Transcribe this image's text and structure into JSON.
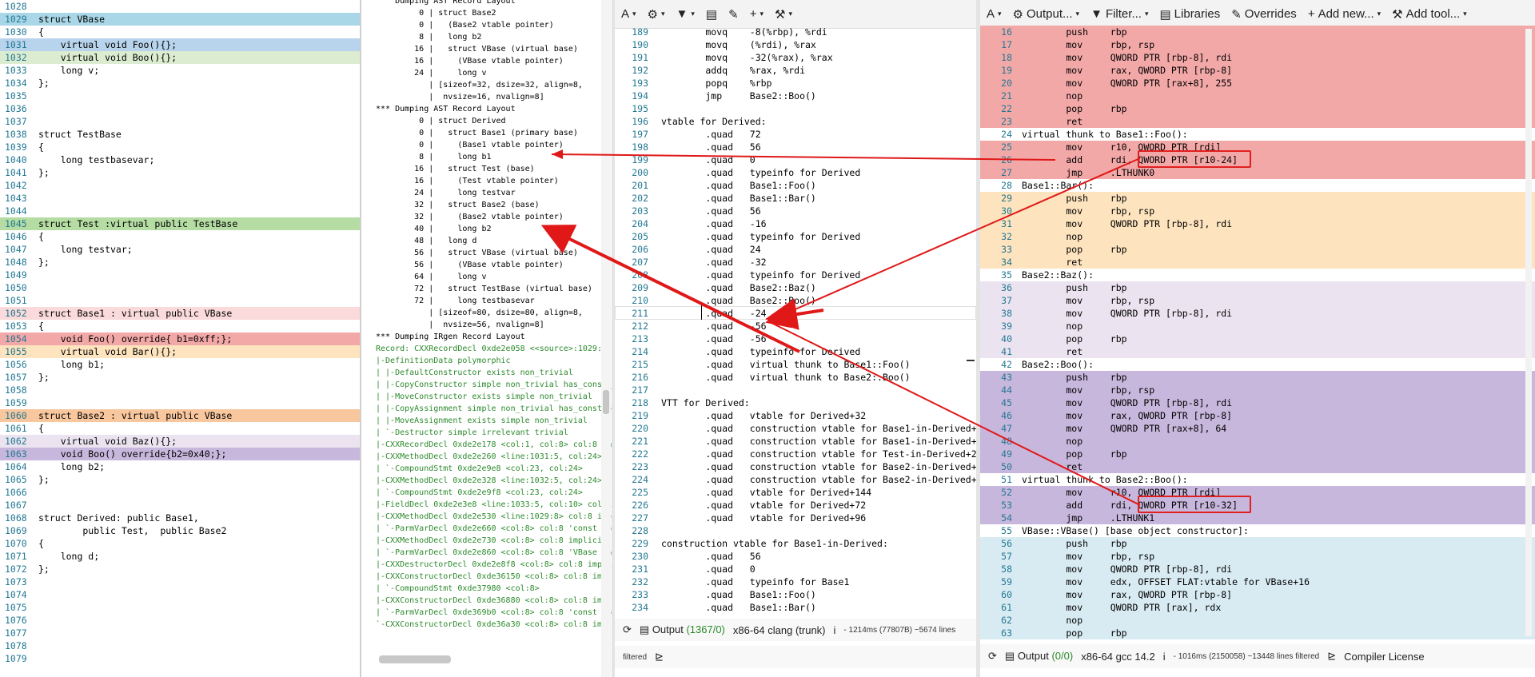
{
  "source_lines": [
    {
      "n": "1028",
      "t": ""
    },
    {
      "n": "1029",
      "t": "struct VBase",
      "cls": "hl-blue",
      "kind": "vbase"
    },
    {
      "n": "1030",
      "t": "{"
    },
    {
      "n": "1031",
      "t": "    virtual void Foo(){};",
      "cls": "hl-blue2"
    },
    {
      "n": "1032",
      "t": "    virtual void Boo(){};",
      "cls": "hl-green"
    },
    {
      "n": "1033",
      "t": "    long v;"
    },
    {
      "n": "1034",
      "t": "};"
    },
    {
      "n": "1035",
      "t": ""
    },
    {
      "n": "1036",
      "t": ""
    },
    {
      "n": "1037",
      "t": ""
    },
    {
      "n": "1038",
      "t": "struct TestBase"
    },
    {
      "n": "1039",
      "t": "{"
    },
    {
      "n": "1040",
      "t": "    long testbasevar;"
    },
    {
      "n": "1041",
      "t": "};"
    },
    {
      "n": "1042",
      "t": ""
    },
    {
      "n": "1043",
      "t": ""
    },
    {
      "n": "1044",
      "t": ""
    },
    {
      "n": "1045",
      "t": "struct Test :virtual public TestBase",
      "cls": "hl-green2"
    },
    {
      "n": "1046",
      "t": "{"
    },
    {
      "n": "1047",
      "t": "    long testvar;"
    },
    {
      "n": "1048",
      "t": "};"
    },
    {
      "n": "1049",
      "t": ""
    },
    {
      "n": "1050",
      "t": ""
    },
    {
      "n": "1051",
      "t": ""
    },
    {
      "n": "1052",
      "t": "struct Base1 : virtual public VBase",
      "cls": "hl-pink"
    },
    {
      "n": "1053",
      "t": "{"
    },
    {
      "n": "1054",
      "t": "    void Foo() override{ b1=0xff;};",
      "cls": "hl-red"
    },
    {
      "n": "1055",
      "t": "    virtual void Bar(){};",
      "cls": "hl-orange"
    },
    {
      "n": "1056",
      "t": "    long b1;"
    },
    {
      "n": "1057",
      "t": "};"
    },
    {
      "n": "1058",
      "t": ""
    },
    {
      "n": "1059",
      "t": ""
    },
    {
      "n": "1060",
      "t": "struct Base2 : virtual public VBase",
      "cls": "hl-orange2"
    },
    {
      "n": "1061",
      "t": "{"
    },
    {
      "n": "1062",
      "t": "    virtual void Baz(){};",
      "cls": "hl-lav"
    },
    {
      "n": "1063",
      "t": "    void Boo() override{b2=0x40;};",
      "cls": "hl-purple"
    },
    {
      "n": "1064",
      "t": "    long b2;"
    },
    {
      "n": "1065",
      "t": "};"
    },
    {
      "n": "1066",
      "t": ""
    },
    {
      "n": "1067",
      "t": ""
    },
    {
      "n": "1068",
      "t": "struct Derived: public Base1,"
    },
    {
      "n": "1069",
      "t": "        public Test,  public Base2"
    },
    {
      "n": "1070",
      "t": "{"
    },
    {
      "n": "1071",
      "t": "    long d;"
    },
    {
      "n": "1072",
      "t": "};"
    },
    {
      "n": "1073",
      "t": ""
    },
    {
      "n": "1074",
      "t": ""
    },
    {
      "n": "1075",
      "t": ""
    },
    {
      "n": "1076",
      "t": ""
    },
    {
      "n": "1077",
      "t": ""
    },
    {
      "n": "1078",
      "t": ""
    },
    {
      "n": "1079",
      "t": ""
    }
  ],
  "ast_lines": [
    "    Dumping AST Record Layout",
    "         0 | struct Base2",
    "         0 |   (Base2 vtable pointer)",
    "         8 |   long b2",
    "        16 |   struct VBase (virtual base)",
    "        16 |     (VBase vtable pointer)",
    "        24 |     long v",
    "           | [sizeof=32, dsize=32, align=8,",
    "           |  nvsize=16, nvalign=8]",
    "",
    "*** Dumping AST Record Layout",
    "         0 | struct Derived",
    "         0 |   struct Base1 (primary base)",
    "         0 |     (Base1 vtable pointer)",
    "         8 |     long b1",
    "        16 |   struct Test (base)",
    "        16 |     (Test vtable pointer)",
    "        24 |     long testvar",
    "        32 |   struct Base2 (base)",
    "        32 |     (Base2 vtable pointer)",
    "        40 |     long b2",
    "        48 |   long d",
    "        56 |   struct VBase (virtual base)",
    "        56 |     (VBase vtable pointer)",
    "        64 |     long v",
    "        72 |   struct TestBase (virtual base)",
    "        72 |     long testbasevar",
    "           | [sizeof=80, dsize=80, align=8,",
    "           |  nvsize=56, nvalign=8]",
    "",
    "*** Dumping IRgen Record Layout",
    "Record: CXXRecordDecl 0xde2e058 <<source>:1029:1, l",
    "|-DefinitionData polymorphic",
    "| |-DefaultConstructor exists non_trivial",
    "| |-CopyConstructor simple non_trivial has_const_pa",
    "| |-MoveConstructor exists simple non_trivial",
    "| |-CopyAssignment simple non_trivial has_const_par",
    "| |-MoveAssignment exists simple non_trivial",
    "| `-Destructor simple irrelevant trivial",
    "|-CXXRecordDecl 0xde2e178 <col:1, col:8> col:8 impl",
    "|-CXXMethodDecl 0xde2e260 <line:1031:5, col:24> col",
    "| `-CompoundStmt 0xde2e9e8 <col:23, col:24>",
    "|-CXXMethodDecl 0xde2e328 <line:1032:5, col:24> col",
    "| `-CompoundStmt 0xde2e9f8 <col:23, col:24>",
    "|-FieldDecl 0xde2e3e8 <line:1033:5, col:10> col:10",
    "|-CXXMethodDecl 0xde2e530 <line:1029:8> col:8 impli",
    "| `-ParmVarDecl 0xde2e660 <col:8> col:8 'const VBas",
    "|-CXXMethodDecl 0xde2e730 <col:8> col:8 implicit op",
    "| `-ParmVarDecl 0xde2e860 <col:8> col:8 'VBase &&'",
    "|-CXXDestructorDecl 0xde2e8f8 <col:8> col:8 implic",
    "|-CXXConstructorDecl 0xde36150 <col:8> col:8 implic",
    "| `-CompoundStmt 0xde37980 <col:8>",
    "|-CXXConstructorDecl 0xde36880 <col:8> col:8 implic",
    "| `-ParmVarDecl 0xde369b0 <col:8> col:8 'const VBas",
    "`-CXXConstructorDecl 0xde36a30 <col:8> col:8 implic"
  ],
  "clang_toolbar": {
    "font": "A",
    "gear": "⚙",
    "filter": "▼",
    "book": "▤",
    "wrench": "🔧",
    "plus": "+",
    "magic": "⁄"
  },
  "clang_lines": [
    {
      "n": "189",
      "t": "        movq    -8(%rbp), %rdi"
    },
    {
      "n": "190",
      "t": "        movq    (%rdi), %rax"
    },
    {
      "n": "191",
      "t": "        movq    -32(%rax), %rax"
    },
    {
      "n": "192",
      "t": "        addq    %rax, %rdi"
    },
    {
      "n": "193",
      "t": "        popq    %rbp"
    },
    {
      "n": "194",
      "t": "        jmp     Base2::Boo()"
    },
    {
      "n": "195",
      "t": ""
    },
    {
      "n": "196",
      "t": "vtable for Derived:"
    },
    {
      "n": "197",
      "t": "        .quad   72"
    },
    {
      "n": "198",
      "t": "        .quad   56"
    },
    {
      "n": "199",
      "t": "        .quad   0"
    },
    {
      "n": "200",
      "t": "        .quad   typeinfo for Derived"
    },
    {
      "n": "201",
      "t": "        .quad   Base1::Foo()"
    },
    {
      "n": "202",
      "t": "        .quad   Base1::Bar()"
    },
    {
      "n": "203",
      "t": "        .quad   56"
    },
    {
      "n": "204",
      "t": "        .quad   -16"
    },
    {
      "n": "205",
      "t": "        .quad   typeinfo for Derived"
    },
    {
      "n": "206",
      "t": "        .quad   24"
    },
    {
      "n": "207",
      "t": "        .quad   -32"
    },
    {
      "n": "208",
      "t": "        .quad   typeinfo for Derived"
    },
    {
      "n": "209",
      "t": "        .quad   Base2::Baz()"
    },
    {
      "n": "210",
      "t": "        .quad   Base2::Boo()"
    },
    {
      "n": "211",
      "t": "        .quad   -24"
    },
    {
      "n": "212",
      "t": "        .quad   -56"
    },
    {
      "n": "213",
      "t": "        .quad   -56"
    },
    {
      "n": "214",
      "t": "        .quad   typeinfo for Derived"
    },
    {
      "n": "215",
      "t": "        .quad   virtual thunk to Base1::Foo()"
    },
    {
      "n": "216",
      "t": "        .quad   virtual thunk to Base2::Boo()"
    },
    {
      "n": "217",
      "t": ""
    },
    {
      "n": "218",
      "t": "VTT for Derived:"
    },
    {
      "n": "219",
      "t": "        .quad   vtable for Derived+32"
    },
    {
      "n": "220",
      "t": "        .quad   construction vtable for Base1-in-Derived+24"
    },
    {
      "n": "221",
      "t": "        .quad   construction vtable for Base1-in-Derived+72"
    },
    {
      "n": "222",
      "t": "        .quad   construction vtable for Test-in-Derived+24"
    },
    {
      "n": "223",
      "t": "        .quad   construction vtable for Base2-in-Derived+24"
    },
    {
      "n": "224",
      "t": "        .quad   construction vtable for Base2-in-Derived+72"
    },
    {
      "n": "225",
      "t": "        .quad   vtable for Derived+144"
    },
    {
      "n": "226",
      "t": "        .quad   vtable for Derived+72"
    },
    {
      "n": "227",
      "t": "        .quad   vtable for Derived+96"
    },
    {
      "n": "228",
      "t": ""
    },
    {
      "n": "229",
      "t": "construction vtable for Base1-in-Derived:"
    },
    {
      "n": "230",
      "t": "        .quad   56"
    },
    {
      "n": "231",
      "t": "        .quad   0"
    },
    {
      "n": "232",
      "t": "        .quad   typeinfo for Base1"
    },
    {
      "n": "233",
      "t": "        .quad   Base1::Foo()"
    },
    {
      "n": "234",
      "t": "        .quad   Base1::Bar()"
    }
  ],
  "clang_status": {
    "output_label": "Output",
    "count": "(1367/0)",
    "compiler": "x86-64 clang (trunk)",
    "info": "i",
    "timing": "- 1214ms (77807B) ~5674 lines",
    "filtered": "filtered"
  },
  "gcc_toolbar": {
    "font": "A",
    "output": "Output...",
    "filter": "Filter...",
    "libraries": "Libraries",
    "overrides": "Overrides",
    "add_new": "Add new...",
    "add_tool": "Add tool..."
  },
  "gcc_lines": [
    {
      "n": "16",
      "t": "        push    rbp",
      "cls": "hl-red"
    },
    {
      "n": "17",
      "t": "        mov     rbp, rsp",
      "cls": "hl-red"
    },
    {
      "n": "18",
      "t": "        mov     QWORD PTR [rbp-8], rdi",
      "cls": "hl-red"
    },
    {
      "n": "19",
      "t": "        mov     rax, QWORD PTR [rbp-8]",
      "cls": "hl-red"
    },
    {
      "n": "20",
      "t": "        mov     QWORD PTR [rax+8], 255",
      "cls": "hl-red"
    },
    {
      "n": "21",
      "t": "        nop",
      "cls": "hl-red"
    },
    {
      "n": "22",
      "t": "        pop     rbp",
      "cls": "hl-red"
    },
    {
      "n": "23",
      "t": "        ret",
      "cls": "hl-red"
    },
    {
      "n": "24",
      "t": "virtual thunk to Base1::Foo():"
    },
    {
      "n": "25",
      "t": "        mov     r10, QWORD PTR [rdi]",
      "cls": "hl-red"
    },
    {
      "n": "26",
      "t": "        add     rdi, QWORD PTR [r10-24]",
      "cls": "hl-red"
    },
    {
      "n": "27",
      "t": "        jmp     .LTHUNK0",
      "cls": "hl-red"
    },
    {
      "n": "28",
      "t": "Base1::Bar():"
    },
    {
      "n": "29",
      "t": "        push    rbp",
      "cls": "hl-orange"
    },
    {
      "n": "30",
      "t": "        mov     rbp, rsp",
      "cls": "hl-orange"
    },
    {
      "n": "31",
      "t": "        mov     QWORD PTR [rbp-8], rdi",
      "cls": "hl-orange"
    },
    {
      "n": "32",
      "t": "        nop",
      "cls": "hl-orange"
    },
    {
      "n": "33",
      "t": "        pop     rbp",
      "cls": "hl-orange"
    },
    {
      "n": "34",
      "t": "        ret",
      "cls": "hl-orange"
    },
    {
      "n": "35",
      "t": "Base2::Baz():"
    },
    {
      "n": "36",
      "t": "        push    rbp",
      "cls": "hl-lav"
    },
    {
      "n": "37",
      "t": "        mov     rbp, rsp",
      "cls": "hl-lav"
    },
    {
      "n": "38",
      "t": "        mov     QWORD PTR [rbp-8], rdi",
      "cls": "hl-lav"
    },
    {
      "n": "39",
      "t": "        nop",
      "cls": "hl-lav"
    },
    {
      "n": "40",
      "t": "        pop     rbp",
      "cls": "hl-lav"
    },
    {
      "n": "41",
      "t": "        ret",
      "cls": "hl-lav"
    },
    {
      "n": "42",
      "t": "Base2::Boo():"
    },
    {
      "n": "43",
      "t": "        push    rbp",
      "cls": "hl-purple"
    },
    {
      "n": "44",
      "t": "        mov     rbp, rsp",
      "cls": "hl-purple"
    },
    {
      "n": "45",
      "t": "        mov     QWORD PTR [rbp-8], rdi",
      "cls": "hl-purple"
    },
    {
      "n": "46",
      "t": "        mov     rax, QWORD PTR [rbp-8]",
      "cls": "hl-purple"
    },
    {
      "n": "47",
      "t": "        mov     QWORD PTR [rax+8], 64",
      "cls": "hl-purple"
    },
    {
      "n": "48",
      "t": "        nop",
      "cls": "hl-purple"
    },
    {
      "n": "49",
      "t": "        pop     rbp",
      "cls": "hl-purple"
    },
    {
      "n": "50",
      "t": "        ret",
      "cls": "hl-purple"
    },
    {
      "n": "51",
      "t": "virtual thunk to Base2::Boo():"
    },
    {
      "n": "52",
      "t": "        mov     r10, QWORD PTR [rdi]",
      "cls": "hl-purple"
    },
    {
      "n": "53",
      "t": "        add     rdi, QWORD PTR [r10-32]",
      "cls": "hl-purple"
    },
    {
      "n": "54",
      "t": "        jmp     .LTHUNK1",
      "cls": "hl-purple"
    },
    {
      "n": "55",
      "t": "VBase::VBase() [base object constructor]:"
    },
    {
      "n": "56",
      "t": "        push    rbp",
      "cls": "hl-cyan"
    },
    {
      "n": "57",
      "t": "        mov     rbp, rsp",
      "cls": "hl-cyan"
    },
    {
      "n": "58",
      "t": "        mov     QWORD PTR [rbp-8], rdi",
      "cls": "hl-cyan"
    },
    {
      "n": "59",
      "t": "        mov     edx, OFFSET FLAT:vtable for VBase+16",
      "cls": "hl-cyan"
    },
    {
      "n": "60",
      "t": "        mov     rax, QWORD PTR [rbp-8]",
      "cls": "hl-cyan"
    },
    {
      "n": "61",
      "t": "        mov     QWORD PTR [rax], rdx",
      "cls": "hl-cyan"
    },
    {
      "n": "62",
      "t": "        nop",
      "cls": "hl-cyan"
    },
    {
      "n": "63",
      "t": "        pop     rbp",
      "cls": "hl-cyan"
    }
  ],
  "gcc_status": {
    "output_label": "Output",
    "count": "(0/0)",
    "compiler": "x86-64 gcc 14.2",
    "info": "i",
    "timing": "- 1016ms (2150058) ~13448 lines filtered",
    "license": "Compiler License"
  },
  "annotation_color": "#e01818"
}
